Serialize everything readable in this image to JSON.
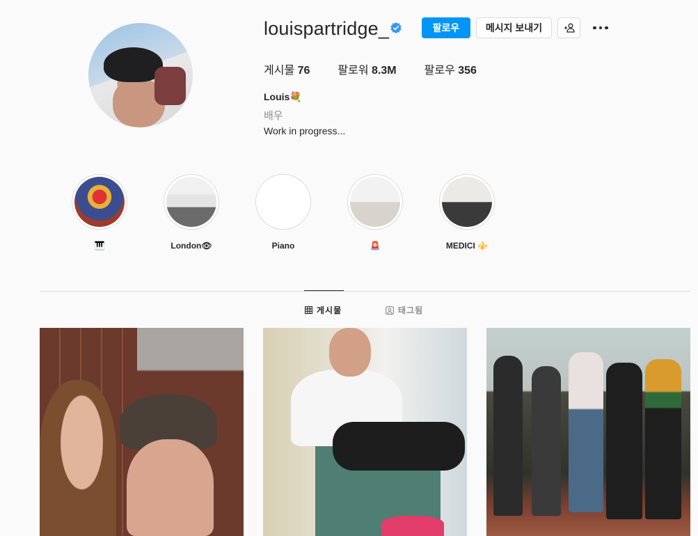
{
  "profile": {
    "username": "louispartridge_",
    "follow_label": "팔로우",
    "message_label": "메시지 보내기",
    "stats": {
      "posts_label": "게시물",
      "posts_value": "76",
      "followers_label": "팔로워",
      "followers_value": "8.3M",
      "following_label": "팔로우",
      "following_value": "356"
    },
    "name": "Louis💐",
    "category": "배우",
    "bio": "Work in progress..."
  },
  "highlights": [
    {
      "label": "🎹"
    },
    {
      "label": "London👁"
    },
    {
      "label": "Piano"
    },
    {
      "label": "🚨"
    },
    {
      "label": "MEDICI ⚜️"
    }
  ],
  "tabs": {
    "posts": "게시물",
    "tagged": "태그됨"
  },
  "colors": {
    "accent": "#0095f6",
    "verified": "#3897f0",
    "text": "#262626",
    "muted": "#8e8e8e",
    "border": "#dbdbdb",
    "background": "#fafafa"
  },
  "icons": [
    "verified-badge-icon",
    "add-person-icon",
    "more-options-icon",
    "grid-icon",
    "tag-icon"
  ]
}
